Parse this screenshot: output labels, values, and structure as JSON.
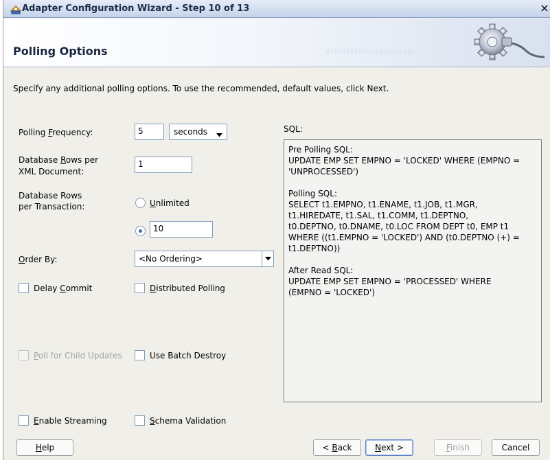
{
  "window": {
    "title": "Adapter Configuration Wizard - Step 10 of 13",
    "close_glyph": "×"
  },
  "header": {
    "title": "Polling Options",
    "binary_text": "0101010101010101010101"
  },
  "instructions": "Specify any additional polling options.  To use the recommended, default values, click Next.",
  "form": {
    "polling_frequency": {
      "label": {
        "pre": "Polling ",
        "key": "F",
        "post": "requency:"
      },
      "value": "5",
      "unit": "seconds"
    },
    "rows_per_xml": {
      "label_line1": {
        "pre": "Database ",
        "key": "R",
        "post": "ows per"
      },
      "label_line2": "XML Document:",
      "value": "1"
    },
    "rows_per_transaction": {
      "label_line1": "Database Rows",
      "label_line2": "per Transaction:",
      "unlimited": {
        "pre": "",
        "key": "U",
        "post": "nlimited",
        "selected": false
      },
      "limited_value": "10",
      "limited_selected": true
    },
    "order_by": {
      "label": {
        "pre": "",
        "key": "O",
        "post": "rder By:"
      },
      "value": "<No Ordering>"
    },
    "delay_commit": {
      "pre": "Delay ",
      "key": "C",
      "post": "ommit",
      "checked": false
    },
    "distributed_polling": {
      "pre": "",
      "key": "D",
      "post": "istributed Polling",
      "checked": false
    },
    "poll_child_updates": {
      "pre": "",
      "key": "P",
      "post": "oll for Child Updates",
      "checked": false,
      "enabled": false
    },
    "use_batch_destroy": {
      "label": "Use Batch Destroy",
      "checked": false
    },
    "enable_streaming": {
      "pre": "",
      "key": "E",
      "post": "nable Streaming",
      "checked": false
    },
    "schema_validation": {
      "pre": "",
      "key": "S",
      "post": "chema Validation",
      "checked": false
    }
  },
  "sql": {
    "label": "SQL:",
    "text": "Pre Polling SQL:\nUPDATE EMP SET EMPNO = 'LOCKED' WHERE (EMPNO =\n'UNPROCESSED')\n\nPolling SQL:\nSELECT t1.EMPNO, t1.ENAME, t1.JOB, t1.MGR,\nt1.HIREDATE, t1.SAL, t1.COMM, t1.DEPTNO,\nt0.DEPTNO, t0.DNAME, t0.LOC FROM DEPT t0, EMP t1\nWHERE ((t1.EMPNO = 'LOCKED') AND (t0.DEPTNO (+) =\nt1.DEPTNO))\n\nAfter Read SQL:\nUPDATE EMP SET EMPNO = 'PROCESSED' WHERE\n(EMPNO = 'LOCKED')"
  },
  "buttons": {
    "help": {
      "pre": "",
      "key": "H",
      "post": "elp"
    },
    "back": {
      "pre": "< ",
      "key": "B",
      "post": "ack"
    },
    "next": {
      "pre": "",
      "key": "N",
      "post": "ext >"
    },
    "finish": {
      "pre": "",
      "key": "F",
      "post": "inish",
      "enabled": false
    },
    "cancel": {
      "label": "Cancel"
    }
  }
}
